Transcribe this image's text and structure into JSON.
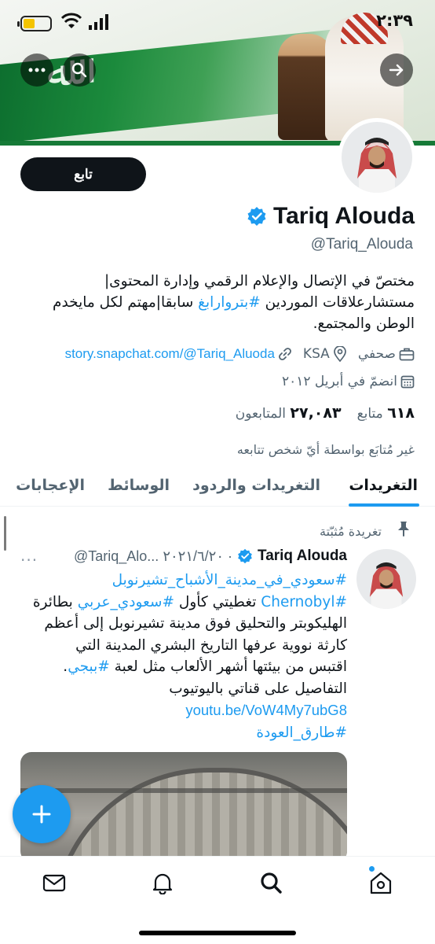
{
  "status_bar": {
    "time": "٢:٣٩"
  },
  "profile": {
    "follow_label": "تابع",
    "name": "Tariq Alouda",
    "handle": "@Tariq_Alouda",
    "bio_line1": "مختصّ في الإتصال والإعلام الرقمي وإدارة المحتوى|",
    "bio_line2_pre": "مستشارعلاقات الموردين ",
    "bio_line2_tag": "#بتروارابغ",
    "bio_line2_post": " سابقا|مهتم لكل مايخدم",
    "bio_line3": "الوطن والمجتمع.",
    "job": "صحفي",
    "location": "KSA",
    "website": "story.snapchat.com/@Tariq_Aluoda",
    "joined": "انضمّ في أبريل ٢٠١٢",
    "following_count": "٦١٨",
    "following_label": "متابع",
    "followers_count": "٢٧,٠٨٣",
    "followers_label": "المتابعون",
    "not_followed": "غير مُتابَع بواسطة أيّ شخص تتابعه"
  },
  "tabs": {
    "tweets": "التغريدات",
    "replies": "التغريدات والردود",
    "media": "الوسائط",
    "likes": "الإعجابات"
  },
  "tweet": {
    "pinned_label": "تغريدة مُثبّتة",
    "name": "Tariq Alouda",
    "handle_date": "@Tariq_Alo... ٢٠٢١/٦/٢٠ ·",
    "more": "···",
    "line1_tag": "#سعودي_في_مدينة_الأشباح_تشيرنوبل",
    "line2_tag1": "#Chernobyl",
    "line2_mid": " تغطيتي كأول ",
    "line2_tag2": "#سعودي_عربي",
    "line2_post": " بطائرة",
    "line3": "الهليكوبتر والتحليق فوق مدينة تشيرنوبل إلى أعظم",
    "line4": "كارثة نووية عرفها التاريخ البشري المدينة التي",
    "line5_pre": "اقتبس من بيئتها أشهر الألعاب مثل لعبة ",
    "line5_tag": "#ببجي",
    "line5_post": ".",
    "line6": "التفاصيل على قناتي باليوتيوب",
    "link": "youtu.be/VoW4My7ubG8",
    "hashtag2": "#طارق_العودة"
  },
  "icons": {
    "verified": "verified-badge-icon",
    "briefcase": "briefcase-icon",
    "location": "location-pin-icon",
    "link": "link-icon",
    "calendar": "calendar-icon",
    "pin": "pin-icon",
    "compose": "plus-icon",
    "nav": [
      "mail-icon",
      "bell-icon",
      "search-icon",
      "home-icon"
    ]
  },
  "colors": {
    "accent": "#1d9bf0",
    "text": "#0f1419",
    "muted": "#536471"
  }
}
